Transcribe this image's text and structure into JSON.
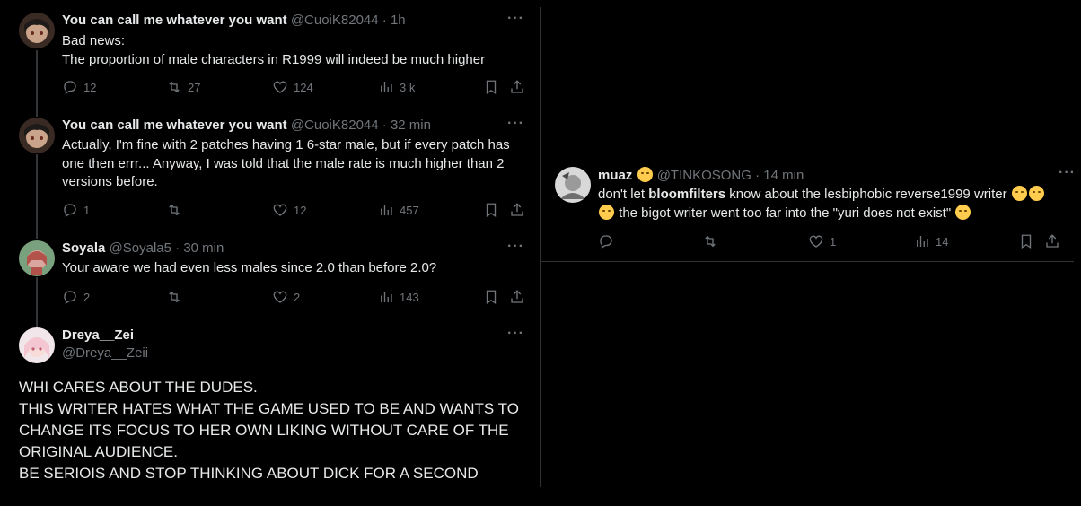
{
  "left_thread": {
    "tweets": [
      {
        "name": "You can call me whatever you want",
        "handle": "@CuoiK82044",
        "sep": "·",
        "time": "1h",
        "lines": [
          "Bad news:",
          "The proportion of male characters in R1999 will indeed be much higher"
        ],
        "replies": "12",
        "retweets": "27",
        "likes": "124",
        "views": "3 k"
      },
      {
        "name": "You can call me whatever you want",
        "handle": "@CuoiK82044",
        "sep": "·",
        "time": "32 min",
        "lines": [
          "Actually, I'm fine with 2 patches having 1 6-star male, but if every patch has",
          "one then errr... Anyway, I was told that the male rate is much higher than 2",
          "versions before."
        ],
        "replies": "1",
        "retweets": "",
        "likes": "12",
        "views": "457"
      },
      {
        "name": "Soyala",
        "handle": "@Soyala5",
        "sep": "·",
        "time": "30 min",
        "lines": [
          "Your aware we had even less males since 2.0 than before 2.0?"
        ],
        "replies": "2",
        "retweets": "",
        "likes": "2",
        "views": "143"
      }
    ],
    "main_tweet": {
      "name": "Dreya__Zei",
      "handle": "@Dreya__Zeii",
      "lines": [
        "WHI CARES ABOUT THE DUDES.",
        "THIS WRITER HATES WHAT THE GAME USED TO BE AND WANTS TO",
        "CHANGE ITS FOCUS TO HER OWN LIKING WITHOUT CARE OF THE",
        "ORIGINAL AUDIENCE.",
        "BE SERIOIS AND STOP THINKING ABOUT DICK FOR A SECOND"
      ]
    }
  },
  "right_tweet": {
    "name": "muaz",
    "handle": "@TINKOSONG",
    "sep": "·",
    "time": "14 min",
    "line1_pre": "don't let ",
    "line1_bold": "bloomfilters",
    "line1_post": " know about the lesbiphobic reverse1999 writer",
    "line2": " the bigot writer went too far into the \"yuri does not exist\"",
    "replies": "",
    "retweets": "",
    "likes": "1",
    "views": "14"
  },
  "more_label": "···",
  "colors": {
    "background": "#000000",
    "text": "#e7e9ea",
    "muted": "#71767b",
    "divider": "#2f3336"
  }
}
